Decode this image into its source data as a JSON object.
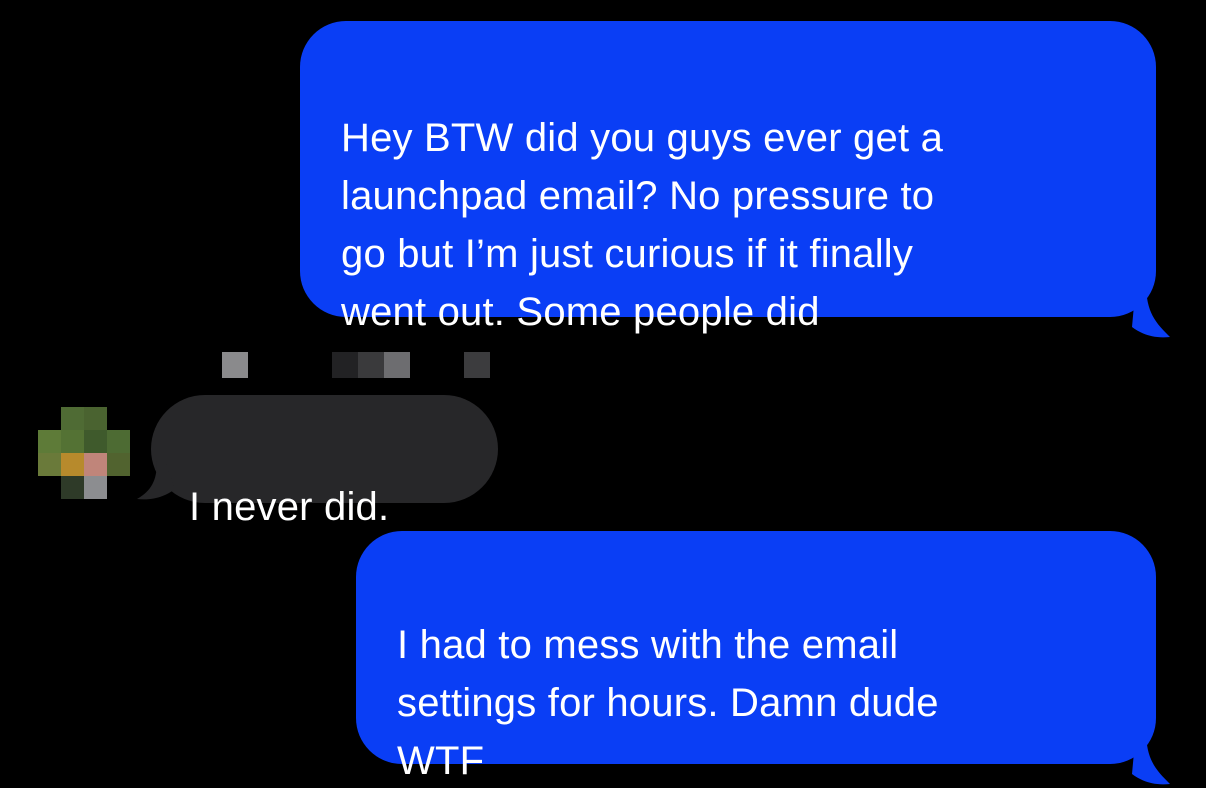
{
  "conversation": {
    "messages": [
      {
        "direction": "outgoing",
        "text": "Hey BTW did you guys ever get a\nlaunchpad email? No pressure to\ngo but I’m just curious if it finally\nwent out. Some people did"
      },
      {
        "direction": "incoming",
        "text": "I never did."
      },
      {
        "direction": "outgoing",
        "text": "I had to mess with the email\nsettings for hours. Damn dude\nWTF"
      }
    ]
  },
  "colors": {
    "background": "#000000",
    "outgoing_bubble": "#0a3ef5",
    "incoming_bubble": "#272729",
    "bubble_text": "#ffffff"
  },
  "redactions": {
    "sender_name": "pixelated",
    "sender_avatar": "pixelated"
  }
}
